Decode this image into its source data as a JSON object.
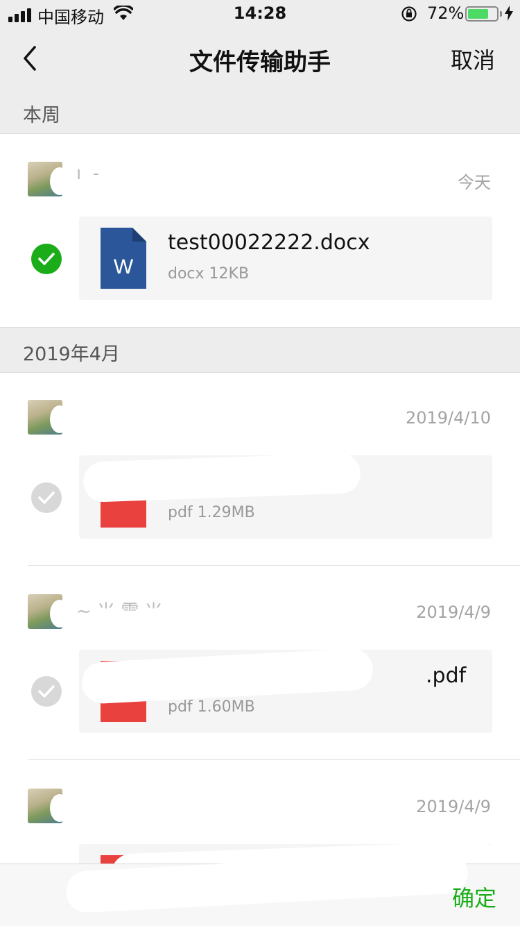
{
  "status_bar": {
    "carrier": "中国移动",
    "time": "14:28",
    "battery": "72%",
    "battery_level": 0.72,
    "icons": [
      "signal-icon",
      "wifi-icon",
      "rotation-lock-icon",
      "battery-icon",
      "charging-icon"
    ]
  },
  "nav": {
    "title": "文件传输助手",
    "cancel": "取消",
    "back_icon": "chevron-left-icon"
  },
  "sections": [
    {
      "header": "本周",
      "entries": [
        {
          "date": "今天",
          "file_name": "test00022222.docx",
          "file_meta": "docx 12KB",
          "file_type": "word",
          "selected": true
        }
      ]
    },
    {
      "header": "2019年4月",
      "entries": [
        {
          "date": "2019/4/10",
          "file_name": "",
          "file_meta": "pdf 1.29MB",
          "file_type": "pdf",
          "selected": false
        },
        {
          "date": "2019/4/9",
          "file_name": ".pdf",
          "file_meta": "pdf 1.60MB",
          "file_type": "pdf",
          "selected": false
        },
        {
          "date": "2019/4/9",
          "file_name": "",
          "file_meta": "",
          "file_type": "pdf",
          "selected": false
        }
      ]
    }
  ],
  "bottom": {
    "confirm": "确定"
  },
  "colors": {
    "accent": "#1aad19",
    "word_blue": "#2b579a",
    "pdf_red": "#e8413e",
    "bar_bg": "#ededed"
  }
}
